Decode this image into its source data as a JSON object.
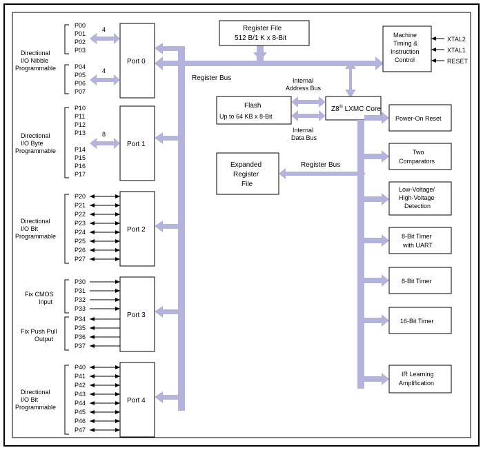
{
  "ports": {
    "port0": {
      "label": "Port 0",
      "desc_l1": "Directional",
      "desc_l2": "I/O Nibble",
      "desc_l3": "Programmable",
      "pins_top": [
        "P00",
        "P01",
        "P02",
        "P03"
      ],
      "pins_bot": [
        "P04",
        "P05",
        "P06",
        "P07"
      ],
      "bus_top": "4",
      "bus_bot": "4"
    },
    "port1": {
      "label": "Port 1",
      "desc_l1": "Directional",
      "desc_l2": "I/O Byte",
      "desc_l3": "Programmable",
      "pins_top": [
        "P10",
        "P11",
        "P12",
        "P13"
      ],
      "pins_bot": [
        "P14",
        "P15",
        "P16",
        "P17"
      ],
      "bus": "8"
    },
    "port2": {
      "label": "Port 2",
      "desc_l1": "Directional",
      "desc_l2": "I/O Bit",
      "desc_l3": "Programmable",
      "pins": [
        "P20",
        "P21",
        "P22",
        "P23",
        "P24",
        "P25",
        "P26",
        "P27"
      ]
    },
    "port3": {
      "label": "Port 3",
      "desc_top_l1": "Fix CMOS",
      "desc_top_l2": "Input",
      "desc_bot_l1": "Fix Push Pull",
      "desc_bot_l2": "Output",
      "pins_top": [
        "P30",
        "P31",
        "P32",
        "P33"
      ],
      "pins_bot": [
        "P34",
        "P35",
        "P36",
        "P37"
      ]
    },
    "port4": {
      "label": "Port 4",
      "desc_l1": "Directional",
      "desc_l2": "I/O Bit",
      "desc_l3": "Programmable",
      "pins": [
        "P40",
        "P41",
        "P42",
        "P43",
        "P44",
        "P45",
        "P46",
        "P47"
      ]
    }
  },
  "blocks": {
    "regfile_l1": "Register File",
    "regfile_l2": "512 B/1 K x 8-Bit",
    "flash_l1": "Flash",
    "flash_l2": "Up to 64 KB x 8-Bit",
    "core_l1": "Z8",
    "core_sup": "®",
    "core_l2": " LXMC Core",
    "expreg_l1": "Expanded",
    "expreg_l2": "Register",
    "expreg_l3": "File",
    "mtic_l1": "Machine",
    "mtic_l2": "Timing &",
    "mtic_l3": "Instruction",
    "mtic_l4": "Control",
    "por": "Power-On Reset",
    "comp_l1": "Two",
    "comp_l2": "Comparators",
    "lvhv_l1": "Low-Voltage/",
    "lvhv_l2": "High-Voltage",
    "lvhv_l3": "Detection",
    "t8u_l1": "8-Bit Timer",
    "t8u_l2": "with UART",
    "t8": "8-Bit Timer",
    "t16": "16-Bit Timer",
    "ir_l1": "IR Learning",
    "ir_l2": "Amplification"
  },
  "bus_labels": {
    "regbus_top": "Register Bus",
    "int_addr_l1": "Internal",
    "int_addr_l2": "Address Bus",
    "int_data_l1": "Internal",
    "int_data_l2": "Data Bus",
    "regbus_mid": "Register Bus"
  },
  "ext_pins": {
    "xtal2": "XTAL2",
    "xtal1": "XTAL1",
    "reset": "RESET"
  },
  "colors": {
    "bus": "#b3b3dd"
  }
}
